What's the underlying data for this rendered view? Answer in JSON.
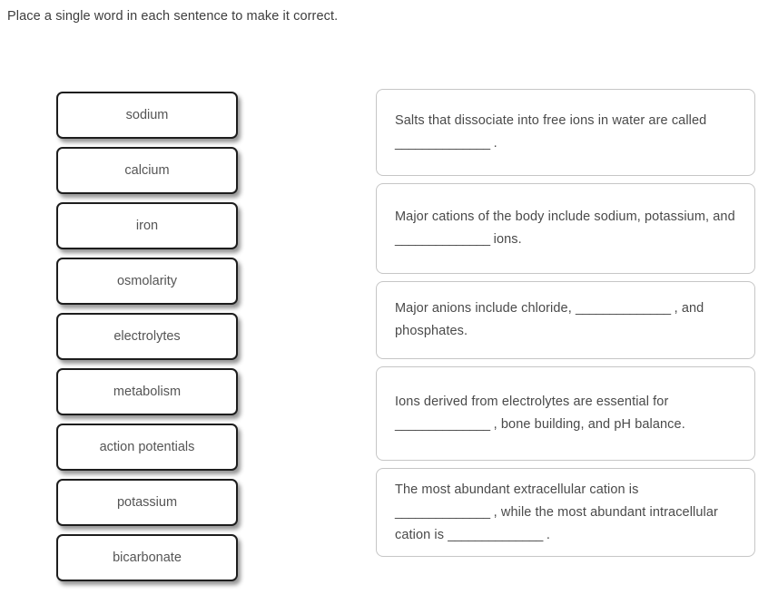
{
  "instruction": "Place a single word in each sentence to make it correct.",
  "word_bank": {
    "tiles": [
      {
        "label": "sodium"
      },
      {
        "label": "calcium"
      },
      {
        "label": "iron"
      },
      {
        "label": "osmolarity"
      },
      {
        "label": "electrolytes"
      },
      {
        "label": "metabolism"
      },
      {
        "label": "action potentials"
      },
      {
        "label": "potassium"
      },
      {
        "label": "bicarbonate"
      }
    ]
  },
  "sentences": {
    "blank_mark": "______________",
    "items": [
      {
        "pre": "Salts that dissociate into free ions in water are called ",
        "post": " .",
        "full_text": "Salts that dissociate into free ions in water are called ______________ ."
      },
      {
        "pre": "Major cations of the body include sodium, potassium, and ",
        "post": " ions.",
        "full_text": "Major cations of the body include sodium, potassium, and ______________ ions."
      },
      {
        "pre": "Major anions include chloride, ",
        "post": " , and phosphates.",
        "full_text": "Major anions include chloride, ______________ , and phosphates."
      },
      {
        "pre": "Ions derived from electrolytes are essential for ",
        "post": " , bone building, and pH balance.",
        "full_text": "Ions derived from electrolytes are essential for ______________ , bone building, and pH balance."
      },
      {
        "pre": "The most abundant extracellular cation is ",
        "mid": " , while the most abundant intracellular cation is ",
        "post": " .",
        "full_text": "The most abundant extracellular cation is ______________ , while the most abundant intracellular cation is ______________ ."
      }
    ]
  },
  "colors": {
    "page_background": "#ffffff",
    "tile_border": "#1d1d1d",
    "tile_text": "#555555",
    "card_border": "#c6c6c6",
    "card_text": "#4a4a4a",
    "instruction_text": "#3d3d3d"
  }
}
